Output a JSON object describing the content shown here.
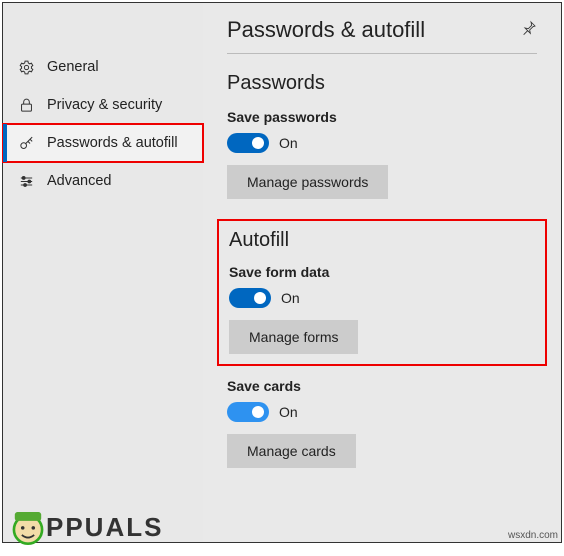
{
  "sidebar": {
    "items": [
      {
        "label": "General"
      },
      {
        "label": "Privacy & security"
      },
      {
        "label": "Passwords & autofill"
      },
      {
        "label": "Advanced"
      }
    ]
  },
  "header": {
    "title": "Passwords & autofill"
  },
  "passwords": {
    "heading": "Passwords",
    "save_label": "Save passwords",
    "toggle_state": "On",
    "manage_label": "Manage passwords"
  },
  "autofill": {
    "heading": "Autofill",
    "save_form_label": "Save form data",
    "form_toggle_state": "On",
    "manage_forms_label": "Manage forms",
    "save_cards_label": "Save cards",
    "cards_toggle_state": "On",
    "manage_cards_label": "Manage cards"
  },
  "watermark": "PPUALS",
  "attribution": "wsxdn.com"
}
